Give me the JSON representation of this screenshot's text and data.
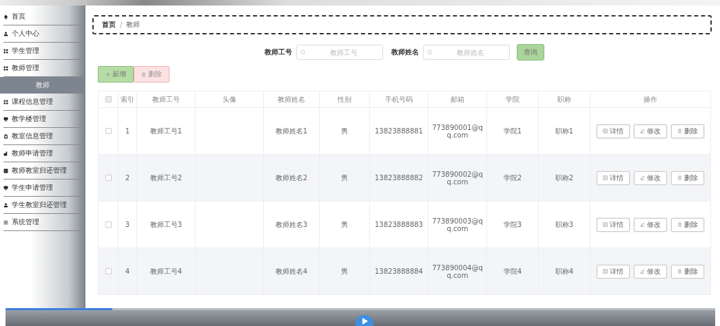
{
  "sidebar": {
    "items": [
      {
        "label": "首页",
        "expandable": false,
        "selected": false
      },
      {
        "label": "个人中心",
        "expandable": true,
        "selected": false
      },
      {
        "label": "学生管理",
        "expandable": true,
        "selected": false
      },
      {
        "label": "教师管理",
        "expandable": true,
        "selected": false,
        "children": [
          {
            "label": "教师",
            "selected": true
          }
        ]
      },
      {
        "label": "课程信息管理",
        "expandable": true,
        "selected": false
      },
      {
        "label": "教学楼管理",
        "expandable": true,
        "selected": false
      },
      {
        "label": "教室信息管理",
        "expandable": true,
        "selected": false
      },
      {
        "label": "教师申请管理",
        "expandable": true,
        "selected": false
      },
      {
        "label": "教师教室归还管理",
        "expandable": true,
        "selected": false
      },
      {
        "label": "学生申请管理",
        "expandable": true,
        "selected": false
      },
      {
        "label": "学生教室归还管理",
        "expandable": true,
        "selected": false
      },
      {
        "label": "系统管理",
        "expandable": true,
        "selected": false
      }
    ]
  },
  "breadcrumb": {
    "items": [
      "首页",
      "教师"
    ],
    "separator": "/"
  },
  "search": {
    "fields": [
      {
        "label": "教师工号",
        "placeholder": "教师工号"
      },
      {
        "label": "教师姓名",
        "placeholder": "教师姓名"
      }
    ],
    "button": "查询"
  },
  "actions": [
    {
      "kind": "add",
      "label": "新增"
    },
    {
      "kind": "delete",
      "label": "删除"
    }
  ],
  "table": {
    "columns": [
      "索引",
      "教师工号",
      "头像",
      "教师姓名",
      "性别",
      "手机号码",
      "邮箱",
      "学院",
      "职称",
      "操作"
    ],
    "all_checked": false,
    "rows": [
      {
        "checked": false,
        "cells": [
          "1",
          "教师工号1",
          "",
          "教师姓名1",
          "男",
          "13823888881",
          "773890001@qq.com",
          "学院1",
          "职称1"
        ],
        "actions": [
          {
            "kind": "detail",
            "label": "详情"
          },
          {
            "kind": "edit",
            "label": "修改"
          },
          {
            "kind": "delete",
            "label": "删除"
          }
        ]
      },
      {
        "checked": false,
        "cells": [
          "2",
          "教师工号2",
          "",
          "教师姓名2",
          "男",
          "13823888882",
          "773890002@qq.com",
          "学院2",
          "职称2"
        ],
        "actions": [
          {
            "kind": "detail",
            "label": "详情"
          },
          {
            "kind": "edit",
            "label": "修改"
          },
          {
            "kind": "delete",
            "label": "删除"
          }
        ]
      },
      {
        "checked": false,
        "cells": [
          "3",
          "教师工号3",
          "",
          "教师姓名3",
          "男",
          "13823888883",
          "773890003@qq.com",
          "学院3",
          "职称3"
        ],
        "actions": [
          {
            "kind": "detail",
            "label": "详情"
          },
          {
            "kind": "edit",
            "label": "修改"
          },
          {
            "kind": "delete",
            "label": "删除"
          }
        ]
      },
      {
        "checked": false,
        "cells": [
          "4",
          "教师工号4",
          "",
          "教师姓名4",
          "男",
          "13823888884",
          "773890004@qq.com",
          "学院4",
          "职称4"
        ],
        "actions": [
          {
            "kind": "detail",
            "label": "详情"
          },
          {
            "kind": "edit",
            "label": "修改"
          },
          {
            "kind": "delete",
            "label": "删除"
          }
        ]
      }
    ]
  },
  "player": {
    "level": 0.15
  }
}
